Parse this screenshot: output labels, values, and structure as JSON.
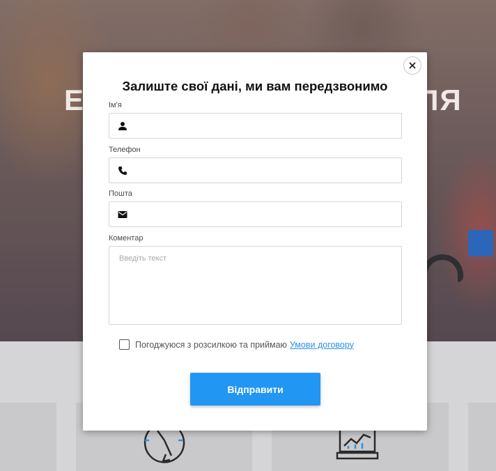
{
  "background": {
    "hero_word_left": "Е",
    "hero_word_right": "ЛЯ",
    "icons": [
      "clock-arrow-icon",
      "chart-board-icon"
    ]
  },
  "modal": {
    "title": "Залиште свої дані, ми вам передзвонимо",
    "close_icon": "close-icon",
    "fields": {
      "name": {
        "label": "Ім'я",
        "value": "",
        "icon": "person-icon"
      },
      "phone": {
        "label": "Телефон",
        "value": "",
        "icon": "phone-icon"
      },
      "email": {
        "label": "Пошта",
        "value": "",
        "icon": "envelope-icon"
      },
      "comment": {
        "label": "Коментар",
        "placeholder": "Введіть текст",
        "value": ""
      }
    },
    "consent": {
      "text": "Погоджуюся з розсилкою та приймаю",
      "link_text": "Умови договору",
      "checked": false
    },
    "submit_label": "Відправити"
  },
  "colors": {
    "accent": "#2196f3",
    "link": "#2b93e6",
    "overlay_gray": "#d5d5d7"
  }
}
